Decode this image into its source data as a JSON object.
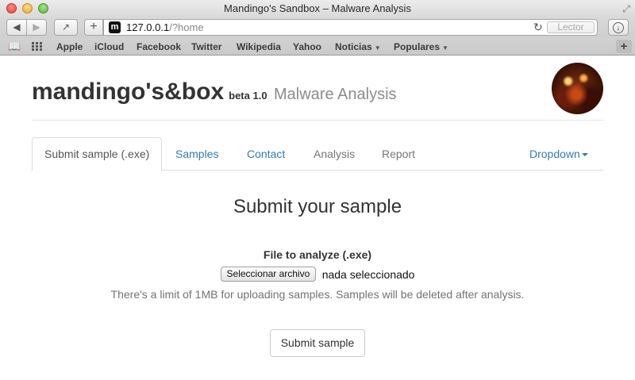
{
  "window": {
    "title": "Mandingo's Sandbox – Malware Analysis"
  },
  "toolbar": {
    "back_icon": "◀",
    "forward_icon": "▶",
    "share_icon": "↗",
    "new_tab_icon": "+",
    "favicon_letter": "m",
    "url_host": "127.0.0.1",
    "url_path": "/?home",
    "reload_icon": "↻",
    "reader_label": "Lector",
    "download_icon": "↓"
  },
  "bookmarks": {
    "items": [
      {
        "label": "Apple"
      },
      {
        "label": "iCloud"
      },
      {
        "label": "Facebook"
      },
      {
        "label": "Twitter"
      },
      {
        "label": "Wikipedia"
      },
      {
        "label": "Yahoo"
      },
      {
        "label": "Noticias",
        "dropdown": true
      },
      {
        "label": "Populares",
        "dropdown": true
      }
    ],
    "add_icon": "+"
  },
  "header": {
    "brand_name": "mandingo's&box",
    "version": "beta 1.0",
    "subtitle": "Malware Analysis"
  },
  "tabs": {
    "items": [
      {
        "label": "Submit sample (.exe)",
        "state": "active"
      },
      {
        "label": "Samples",
        "state": "link"
      },
      {
        "label": "Contact",
        "state": "link"
      },
      {
        "label": "Analysis",
        "state": "disabled"
      },
      {
        "label": "Report",
        "state": "disabled"
      }
    ],
    "dropdown_label": "Dropdown"
  },
  "main": {
    "title": "Submit your sample",
    "field_label": "File to analyze (.exe)",
    "file_button_label": "Seleccionar archivo",
    "file_status": "nada seleccionado",
    "help_text": "There's a limit of 1MB for uploading samples. Samples will be deleted after analysis.",
    "submit_label": "Submit sample"
  },
  "colors": {
    "link": "#337ab7",
    "muted": "#777777",
    "text": "#333333"
  }
}
